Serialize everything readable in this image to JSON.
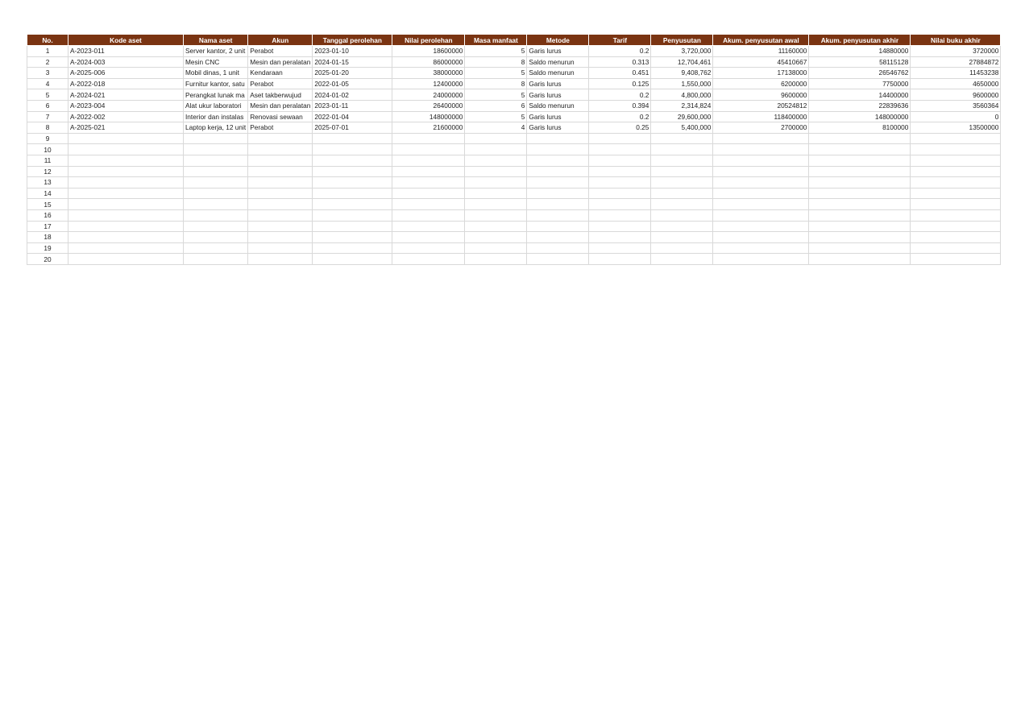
{
  "headers": [
    "No.",
    "Kode aset",
    "Nama aset",
    "Akun",
    "Tanggal perolehan",
    "Nilai perolehan",
    "Masa manfaat",
    "Metode",
    "Tarif",
    "Penyusutan",
    "Akum. penyusutan awal",
    "Akum. penyusutan akhir",
    "Nilai buku akhir"
  ],
  "rows": [
    {
      "no": "1",
      "kode": "A-2023-011",
      "nama": "Server kantor, 2 unit",
      "akun": "Perabot",
      "tanggal": "2023-01-10",
      "nilai": "18600000",
      "masa": "5",
      "metode": "Garis lurus",
      "tarif": "0.2",
      "penyusutan": "3,720,000",
      "akum_awal": "11160000",
      "akum_akhir": "14880000",
      "nilai_buku": "3720000"
    },
    {
      "no": "2",
      "kode": "A-2024-003",
      "nama": "Mesin CNC",
      "akun": "Mesin dan peralatan",
      "tanggal": "2024-01-15",
      "nilai": "86000000",
      "masa": "8",
      "metode": "Saldo menurun",
      "tarif": "0.313",
      "penyusutan": "12,704,461",
      "akum_awal": "45410667",
      "akum_akhir": "58115128",
      "nilai_buku": "27884872"
    },
    {
      "no": "3",
      "kode": "A-2025-006",
      "nama": "Mobil dinas, 1 unit",
      "akun": "Kendaraan",
      "tanggal": "2025-01-20",
      "nilai": "38000000",
      "masa": "5",
      "metode": "Saldo menurun",
      "tarif": "0.451",
      "penyusutan": "9,408,762",
      "akum_awal": "17138000",
      "akum_akhir": "26546762",
      "nilai_buku": "11453238"
    },
    {
      "no": "4",
      "kode": "A-2022-018",
      "nama": "Furnitur kantor, satu",
      "akun": "Perabot",
      "tanggal": "2022-01-05",
      "nilai": "12400000",
      "masa": "8",
      "metode": "Garis lurus",
      "tarif": "0.125",
      "penyusutan": "1,550,000",
      "akum_awal": "6200000",
      "akum_akhir": "7750000",
      "nilai_buku": "4650000"
    },
    {
      "no": "5",
      "kode": "A-2024-021",
      "nama": "Perangkat lunak ma",
      "akun": "Aset takberwujud",
      "tanggal": "2024-01-02",
      "nilai": "24000000",
      "masa": "5",
      "metode": "Garis lurus",
      "tarif": "0.2",
      "penyusutan": "4,800,000",
      "akum_awal": "9600000",
      "akum_akhir": "14400000",
      "nilai_buku": "9600000"
    },
    {
      "no": "6",
      "kode": "A-2023-004",
      "nama": "Alat ukur laboratori",
      "akun": "Mesin dan peralatan",
      "tanggal": "2023-01-11",
      "nilai": "26400000",
      "masa": "6",
      "metode": "Saldo menurun",
      "tarif": "0.394",
      "penyusutan": "2,314,824",
      "akum_awal": "20524812",
      "akum_akhir": "22839636",
      "nilai_buku": "3560364"
    },
    {
      "no": "7",
      "kode": "A-2022-002",
      "nama": "Interior dan instalas",
      "akun": "Renovasi sewaan",
      "tanggal": "2022-01-04",
      "nilai": "148000000",
      "masa": "5",
      "metode": "Garis lurus",
      "tarif": "0.2",
      "penyusutan": "29,600,000",
      "akum_awal": "118400000",
      "akum_akhir": "148000000",
      "nilai_buku": "0"
    },
    {
      "no": "8",
      "kode": "A-2025-021",
      "nama": "Laptop kerja, 12 unit",
      "akun": "Perabot",
      "tanggal": "2025-07-01",
      "nilai": "21600000",
      "masa": "4",
      "metode": "Garis lurus",
      "tarif": "0.25",
      "penyusutan": "5,400,000",
      "akum_awal": "2700000",
      "akum_akhir": "8100000",
      "nilai_buku": "13500000"
    }
  ],
  "empty_row_numbers": [
    "9",
    "10",
    "11",
    "12",
    "13",
    "14",
    "15",
    "16",
    "17",
    "18",
    "19",
    "20"
  ]
}
